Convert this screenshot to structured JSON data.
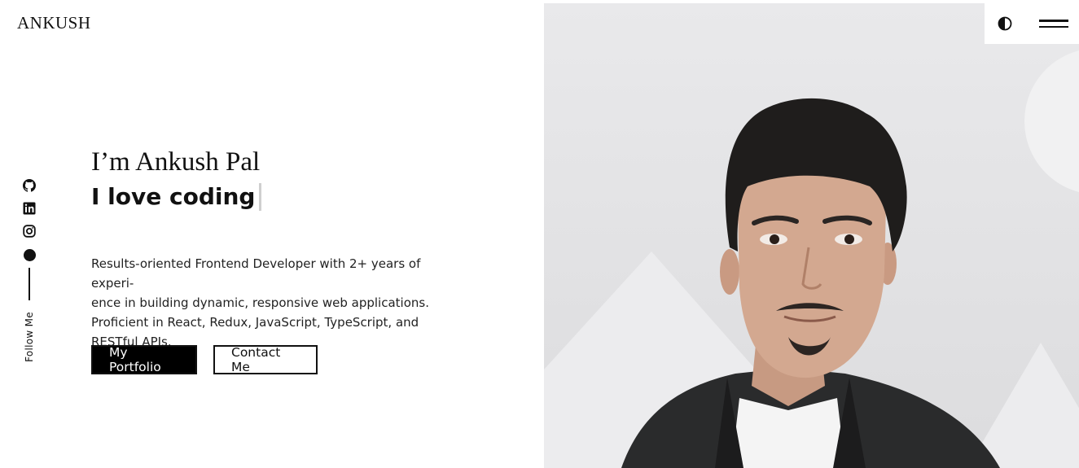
{
  "brand": {
    "logo": "ANKUSH"
  },
  "social": {
    "icons": [
      "github-icon",
      "linkedin-icon",
      "instagram-icon",
      "dot-icon"
    ],
    "follow_label": "Follow Me"
  },
  "hero": {
    "greeting": "I’m Ankush Pal",
    "tagline": "I love coding",
    "description_lines": [
      "Results-oriented Frontend Developer with 2+ years of experi-",
      "ence in building dynamic, responsive web applications.",
      "Proficient in React, Redux, JavaScript, TypeScript, and",
      "RESTful APIs."
    ],
    "primary_button": "My Portfolio",
    "secondary_button": "Contact Me"
  },
  "header_controls": {
    "theme_icon": "half-circle-contrast-icon",
    "menu_icon": "hamburger-menu-icon"
  },
  "colors": {
    "background": "#ffffff",
    "text": "#111111",
    "photo_bg": "#e3e3e5",
    "caret": "#cfcfcf"
  }
}
